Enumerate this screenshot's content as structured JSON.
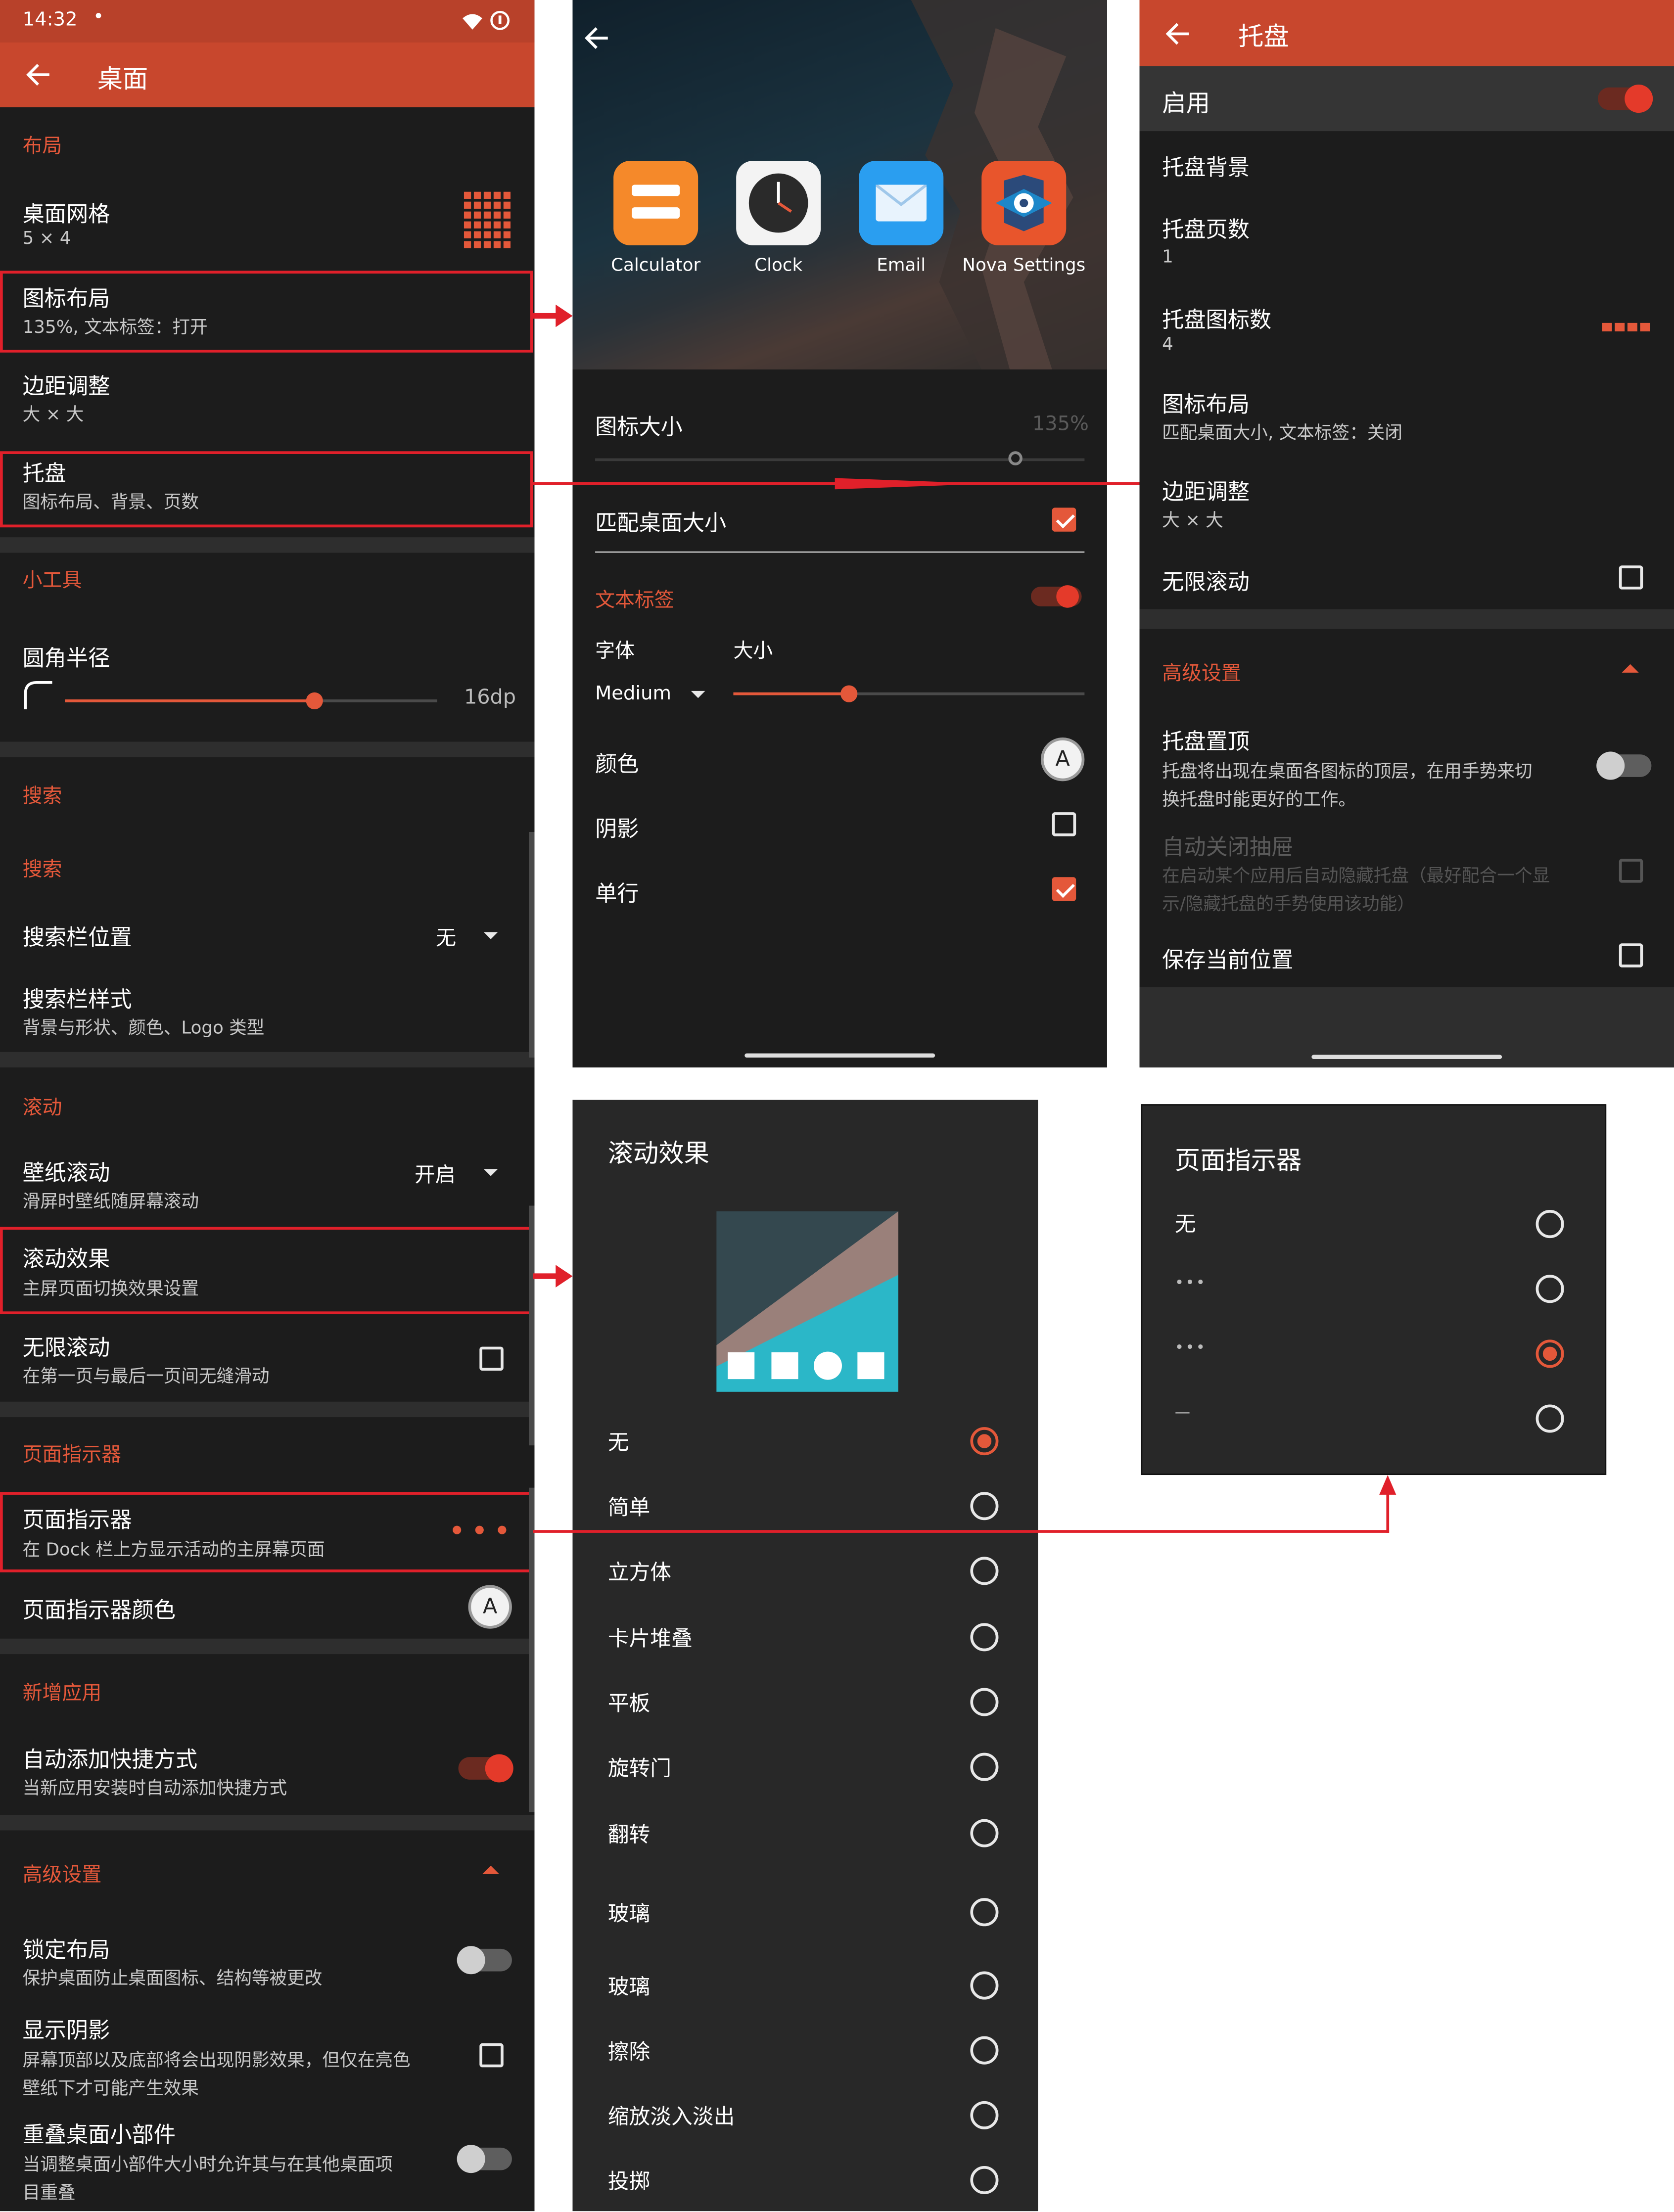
{
  "colors": {
    "accent": "#e4583a",
    "appbar": "#c8472d",
    "highlight": "#e0202a"
  },
  "status": {
    "time": "14:32",
    "dot": "•"
  },
  "p1": {
    "title": "桌面",
    "sec_layout": "布局",
    "grid_title": "桌面网格",
    "grid_sub": "5 × 4",
    "iconlayout_title": "图标布局",
    "iconlayout_sub": "135%, 文本标签：打开",
    "margin_title": "边距调整",
    "margin_sub": "大 × 大",
    "dock_title": "托盘",
    "dock_sub": "图标布局、背景、页数",
    "sec_widgets": "小工具",
    "radius_title": "圆角半径",
    "radius_value": "16dp",
    "radius_level": 0.67,
    "sec_search": "搜索",
    "search_sub_head": "搜索",
    "bar_pos_title": "搜索栏位置",
    "bar_pos_value": "无",
    "bar_style_title": "搜索栏样式",
    "bar_style_sub": "背景与形状、颜色、Logo 类型",
    "sec_scroll": "滚动",
    "wall_title": "壁纸滚动",
    "wall_sub": "滑屏时壁纸随屏幕滚动",
    "wall_value": "开启",
    "effect_title": "滚动效果",
    "effect_sub": "主屏页面切换效果设置",
    "inf_title": "无限滚动",
    "inf_sub": "在第一页与最后一页间无缝滑动",
    "sec_indicator": "页面指示器",
    "ind_title": "页面指示器",
    "ind_sub": "在 Dock 栏上方显示活动的主屏幕页面",
    "ind_color_title": "页面指示器颜色",
    "badge": "A",
    "sec_newapp": "新增应用",
    "auto_title": "自动添加快捷方式",
    "auto_sub": "当新应用安装时自动添加快捷方式",
    "sec_adv": "高级设置",
    "lock_title": "锁定布局",
    "lock_sub": "保护桌面防止桌面图标、结构等被更改",
    "shadow_title": "显示阴影",
    "shadow_sub1": "屏幕顶部以及底部将会出现阴影效果，但仅在亮色",
    "shadow_sub2": "壁纸下才可能产生效果",
    "overlap_title": "重叠桌面小部件",
    "overlap_sub1": "当调整桌面小部件大小时允许其与在其他桌面项",
    "overlap_sub2": "目重叠"
  },
  "p2": {
    "apps": [
      {
        "label": "Calculator",
        "icon": "calculator-icon"
      },
      {
        "label": "Clock",
        "icon": "clock-icon"
      },
      {
        "label": "Email",
        "icon": "email-icon"
      },
      {
        "label": "Nova Settings",
        "icon": "nova-settings-icon"
      }
    ],
    "icon_size_title": "图标大小",
    "icon_size_value": "135%",
    "icon_size_level": 0.86,
    "match_title": "匹配桌面大小",
    "label_head": "文本标签",
    "font_label": "字体",
    "size_label": "大小",
    "font_value": "Medium",
    "label_size_level": 0.33,
    "color_label": "颜色",
    "badge": "A",
    "shadow_label": "阴影",
    "single_label": "单行"
  },
  "p3": {
    "title": "托盘",
    "enable": "启用",
    "bg": "托盘背景",
    "pages_title": "托盘页数",
    "pages_value": "1",
    "count_title": "托盘图标数",
    "count_value": "4",
    "layout_title": "图标布局",
    "layout_sub": "匹配桌面大小, 文本标签：关闭",
    "margin_title": "边距调整",
    "margin_sub": "大 × 大",
    "inf": "无限滚动",
    "adv": "高级设置",
    "top_title": "托盘置顶",
    "top_sub1": "托盘将出现在桌面各图标的顶层，在用手势来切",
    "top_sub2": "换托盘时能更好的工作。",
    "auto_title": "自动关闭抽屉",
    "auto_sub1": "在启动某个应用后自动隐藏托盘（最好配合一个显",
    "auto_sub2": "示/隐藏托盘的手势使用该功能）",
    "save": "保存当前位置"
  },
  "p4": {
    "title": "滚动效果",
    "options": [
      "无",
      "简单",
      "立方体",
      "卡片堆叠",
      "平板",
      "旋转门",
      "翻转",
      "玻璃",
      "玻璃",
      "擦除",
      "缩放淡入淡出",
      "投掷"
    ],
    "selected": 0
  },
  "p5": {
    "title": "页面指示器",
    "options": [
      {
        "label": "无"
      },
      {
        "label": "•••"
      },
      {
        "label": "•••"
      },
      {
        "label": "—"
      }
    ],
    "selected": 2
  }
}
